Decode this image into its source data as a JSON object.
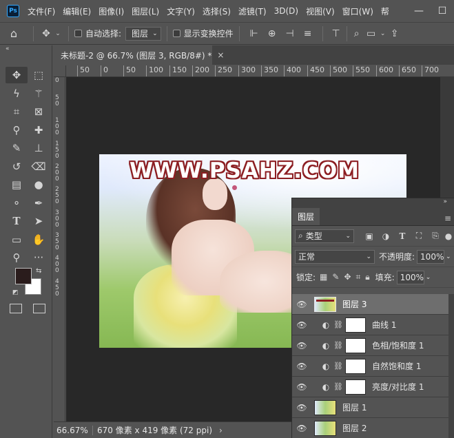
{
  "app": {
    "logo": "Ps"
  },
  "menu": [
    "文件(F)",
    "编辑(E)",
    "图像(I)",
    "图层(L)",
    "文字(Y)",
    "选择(S)",
    "滤镜(T)",
    "3D(D)",
    "视图(V)",
    "窗口(W)",
    "帮"
  ],
  "window_controls": {
    "minimize": "—",
    "maximize": "☐"
  },
  "options": {
    "auto_select_label": "自动选择:",
    "auto_select_value": "图层",
    "show_transform_label": "显示变换控件"
  },
  "document": {
    "tab_title": "未标题-2 @ 66.7% (图层 3, RGB/8#) *",
    "close": "×"
  },
  "ruler": {
    "top_ticks": [
      "50",
      "0",
      "50",
      "100",
      "150",
      "200",
      "250",
      "300",
      "350",
      "400",
      "450",
      "500",
      "550",
      "600",
      "650",
      "700"
    ],
    "left_ticks": [
      "0",
      "5",
      "0",
      "1",
      "0",
      "0",
      "1",
      "5",
      "0",
      "2",
      "0",
      "0",
      "2",
      "5",
      "0",
      "3",
      "0",
      "0",
      "3",
      "5",
      "0",
      "4",
      "0",
      "0",
      "4",
      "5",
      "0"
    ]
  },
  "canvas": {
    "watermark": "WWW.PSAHZ.COM"
  },
  "status": {
    "zoom": "66.67%",
    "info": "670 像素 x 419 像素 (72 ppi)",
    "arrow": "›"
  },
  "layers_panel": {
    "tab": "图层",
    "filter_value": "类型",
    "blend_mode": "正常",
    "opacity_label": "不透明度:",
    "opacity_value": "100%",
    "lock_label": "锁定:",
    "fill_label": "填充:",
    "fill_value": "100%",
    "layers": [
      {
        "name": "图层 3",
        "kind": "pixel",
        "selected": true
      },
      {
        "name": "曲线 1",
        "kind": "adjustment"
      },
      {
        "name": "色相/饱和度 1",
        "kind": "adjustment"
      },
      {
        "name": "自然饱和度 1",
        "kind": "adjustment"
      },
      {
        "name": "亮度/对比度 1",
        "kind": "adjustment"
      },
      {
        "name": "图层 1",
        "kind": "pixel"
      },
      {
        "name": "图层 2",
        "kind": "pixel"
      }
    ]
  },
  "colors": {
    "foreground": "#2a1c1c",
    "background": "#ffffff",
    "accent": "#31a8ff"
  }
}
